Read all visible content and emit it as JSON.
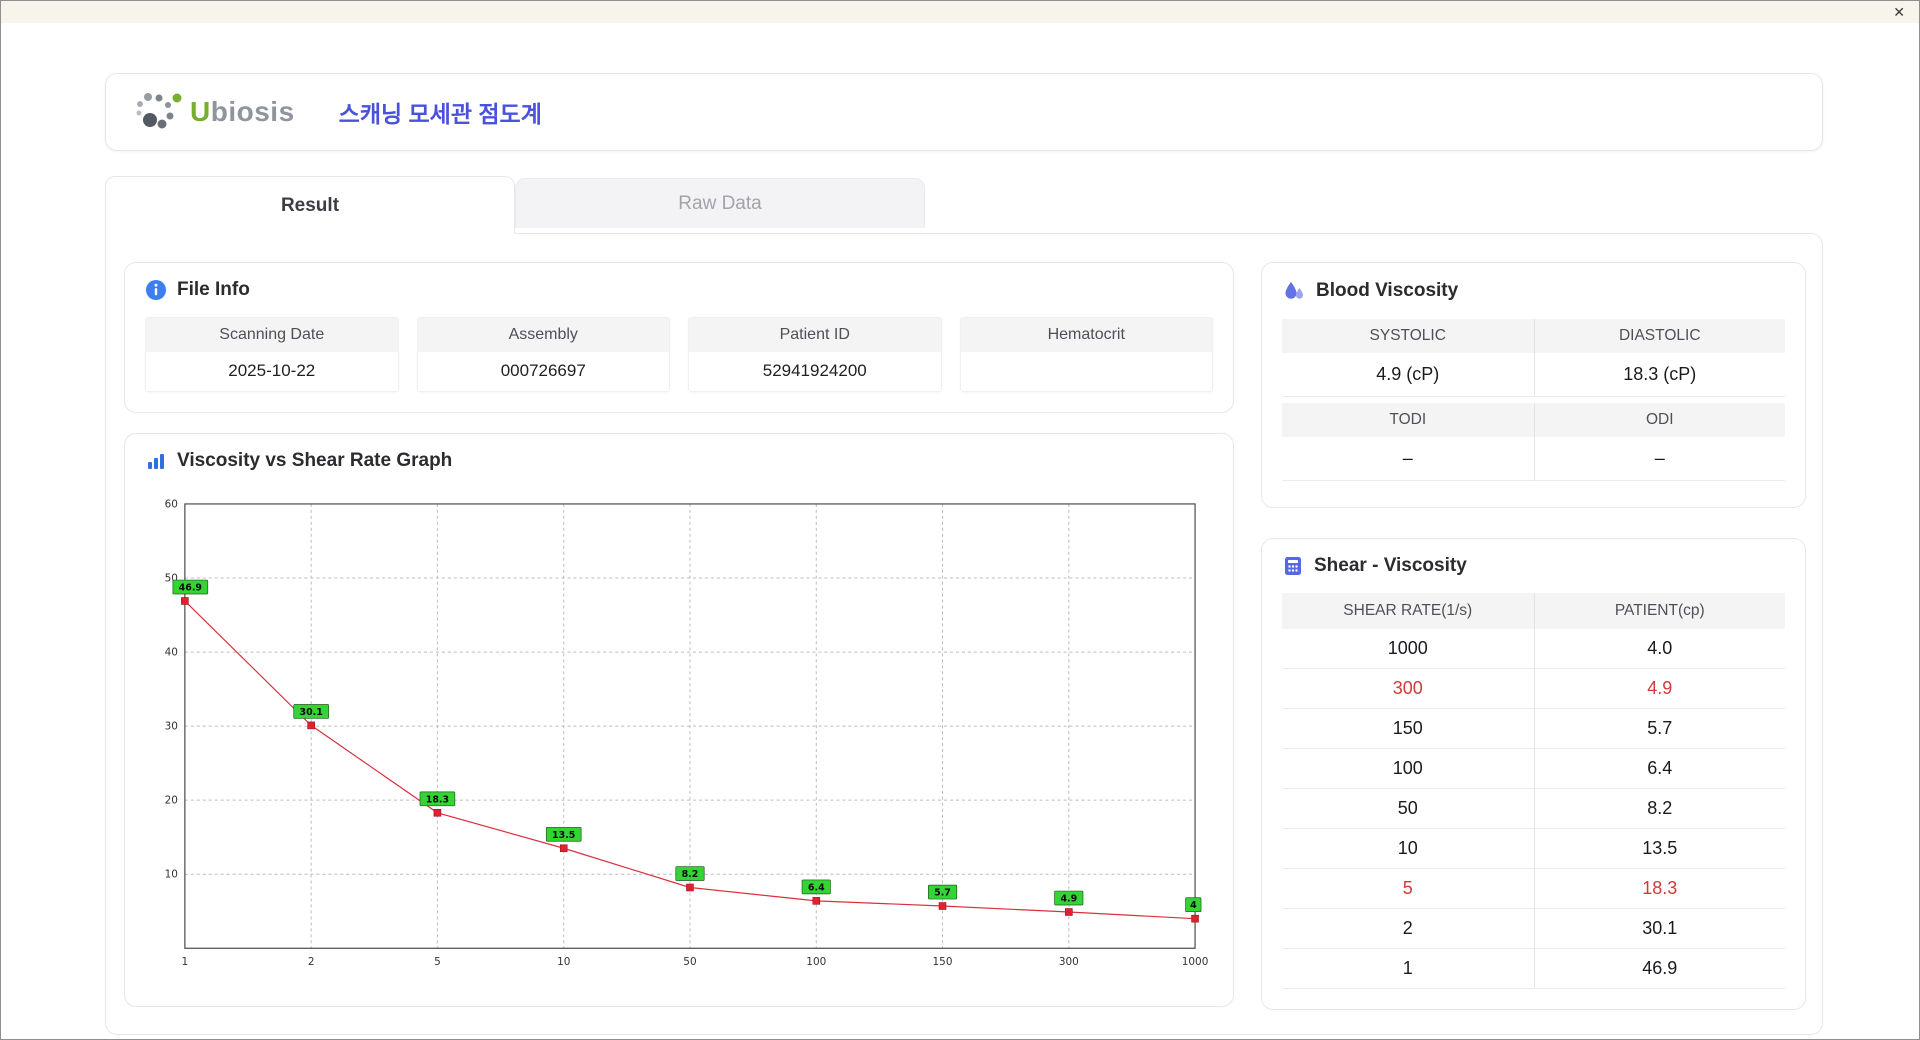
{
  "window": {
    "close_label": "✕"
  },
  "header": {
    "logo_u": "U",
    "logo_rest": "biosis",
    "title": "스캐닝 모세관 점도계"
  },
  "tabs": {
    "result": "Result",
    "raw_data": "Raw Data"
  },
  "file_info": {
    "title": "File Info",
    "fields": [
      {
        "label": "Scanning Date",
        "value": "2025-10-22"
      },
      {
        "label": "Assembly",
        "value": "000726697"
      },
      {
        "label": "Patient ID",
        "value": "52941924200"
      },
      {
        "label": "Hematocrit",
        "value": ""
      }
    ]
  },
  "chart_data": {
    "type": "line",
    "title": "Viscosity vs Shear Rate Graph",
    "x_axis_type": "category",
    "categories": [
      "1",
      "2",
      "5",
      "10",
      "50",
      "100",
      "150",
      "300",
      "1000"
    ],
    "series": [
      {
        "name": "PATIENT(cp)",
        "values": [
          46.9,
          30.1,
          18.3,
          13.5,
          8.2,
          6.4,
          5.7,
          4.9,
          4.0
        ]
      }
    ],
    "point_labels": [
      "46.9",
      "30.1",
      "18.3",
      "13.5",
      "8.2",
      "6.4",
      "5.7",
      "4.9",
      "4"
    ],
    "xlabel": "",
    "ylabel": "",
    "ylim": [
      0,
      60
    ],
    "y_ticks": [
      10,
      20,
      30,
      40,
      50,
      60
    ],
    "grid": true,
    "line_color": "#d93040",
    "marker_color": "#e0222f",
    "point_label_bg": "#35d435"
  },
  "blood_viscosity": {
    "title": "Blood Viscosity",
    "rows": [
      {
        "headers": [
          "SYSTOLIC",
          "DIASTOLIC"
        ],
        "values": [
          "4.9 (cP)",
          "18.3 (cP)"
        ]
      },
      {
        "headers": [
          "TODI",
          "ODI"
        ],
        "values": [
          "–",
          "–"
        ]
      }
    ]
  },
  "shear_viscosity": {
    "title": "Shear - Viscosity",
    "columns": [
      "SHEAR RATE(1/s)",
      "PATIENT(cp)"
    ],
    "rows": [
      {
        "shear_rate": "1000",
        "patient": "4.0",
        "highlight": false
      },
      {
        "shear_rate": "300",
        "patient": "4.9",
        "highlight": true
      },
      {
        "shear_rate": "150",
        "patient": "5.7",
        "highlight": false
      },
      {
        "shear_rate": "100",
        "patient": "6.4",
        "highlight": false
      },
      {
        "shear_rate": "50",
        "patient": "8.2",
        "highlight": false
      },
      {
        "shear_rate": "10",
        "patient": "13.5",
        "highlight": false
      },
      {
        "shear_rate": "5",
        "patient": "18.3",
        "highlight": true
      },
      {
        "shear_rate": "2",
        "patient": "30.1",
        "highlight": false
      },
      {
        "shear_rate": "1",
        "patient": "46.9",
        "highlight": false
      }
    ]
  }
}
